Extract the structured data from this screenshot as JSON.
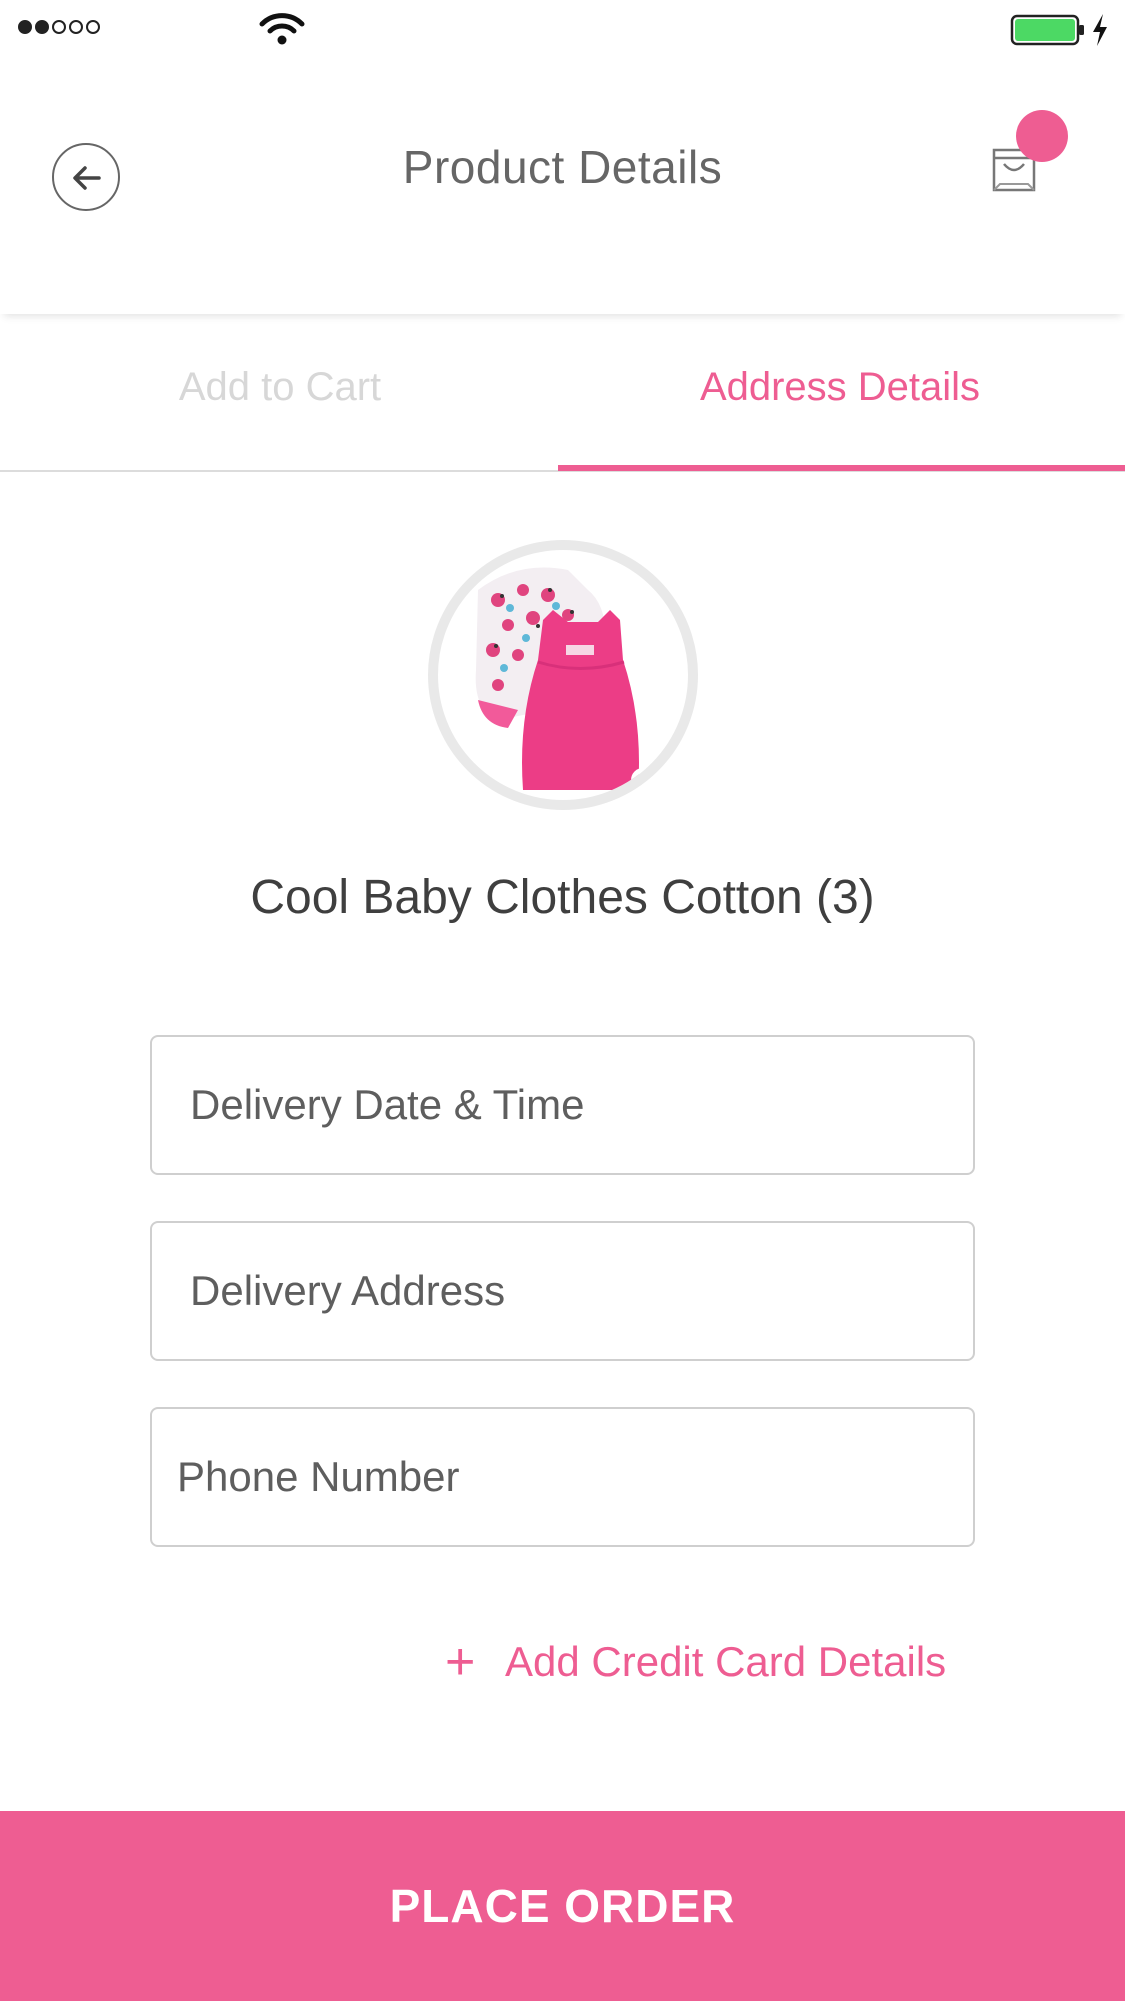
{
  "status_bar": {
    "signal_filled": 2,
    "signal_total": 5,
    "battery_level": 1.0
  },
  "header": {
    "title": "Product Details",
    "back_icon": "arrow-left-icon",
    "cart_icon": "shopping-bag-icon"
  },
  "tabs": [
    {
      "label": "Add to Cart",
      "active": false
    },
    {
      "label": "Address Details",
      "active": true
    }
  ],
  "product": {
    "name": "Cool Baby Clothes Cotton (3)"
  },
  "form": {
    "delivery_datetime": {
      "placeholder": "Delivery Date & Time",
      "value": ""
    },
    "delivery_address": {
      "placeholder": "Delivery Address",
      "value": ""
    },
    "phone_number": {
      "placeholder": "Phone Number",
      "value": ""
    }
  },
  "add_card": {
    "icon": "+",
    "label": "Add Credit Card Details"
  },
  "place_order": {
    "label": "PLACE ORDER"
  },
  "colors": {
    "accent": "#ee5d92",
    "battery": "#4cd964"
  }
}
